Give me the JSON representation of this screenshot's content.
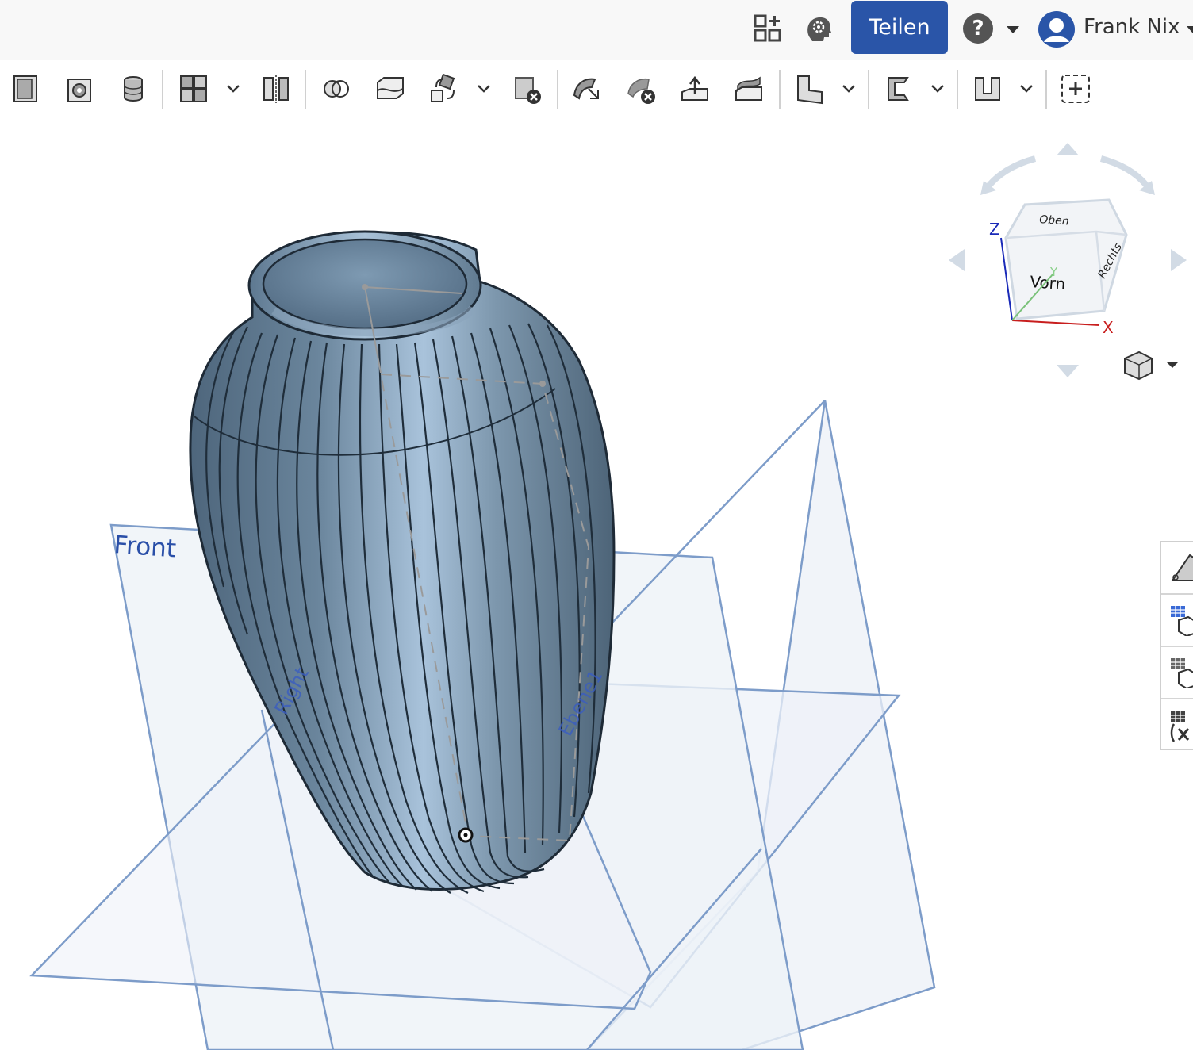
{
  "header": {
    "share_label": "Teilen",
    "help_label": "?",
    "user_name": "Frank Nix",
    "icons": [
      "app-store-icon",
      "gear-brain-icon",
      "help-icon",
      "user-avatar-icon"
    ]
  },
  "toolbar": {
    "tools": [
      "sketch-icon",
      "extrude-icon",
      "revolve-icon",
      "pattern-icon",
      "mirror-icon",
      "boolean-icon",
      "split-icon",
      "transform-icon",
      "delete-part-icon",
      "modify-face-icon",
      "delete-face-icon",
      "move-face-icon",
      "replace-face-icon",
      "plane-icon",
      "sheet-metal-icon",
      "frame-icon",
      "add-feature-icon"
    ]
  },
  "viewcube": {
    "top_label": "Oben",
    "front_label": "Vorn",
    "right_label": "Rechts",
    "axis_z": "Z",
    "axis_x": "X",
    "axis_y": "Y"
  },
  "planes": {
    "front_label": "Front",
    "right_label": "Right",
    "plane_label": "Ebene1"
  },
  "colors": {
    "accent": "#2a55a8",
    "vase": "#6f8ea8",
    "plane_stroke": "#7d9cc9",
    "plane_fill": "#eef2f8"
  }
}
